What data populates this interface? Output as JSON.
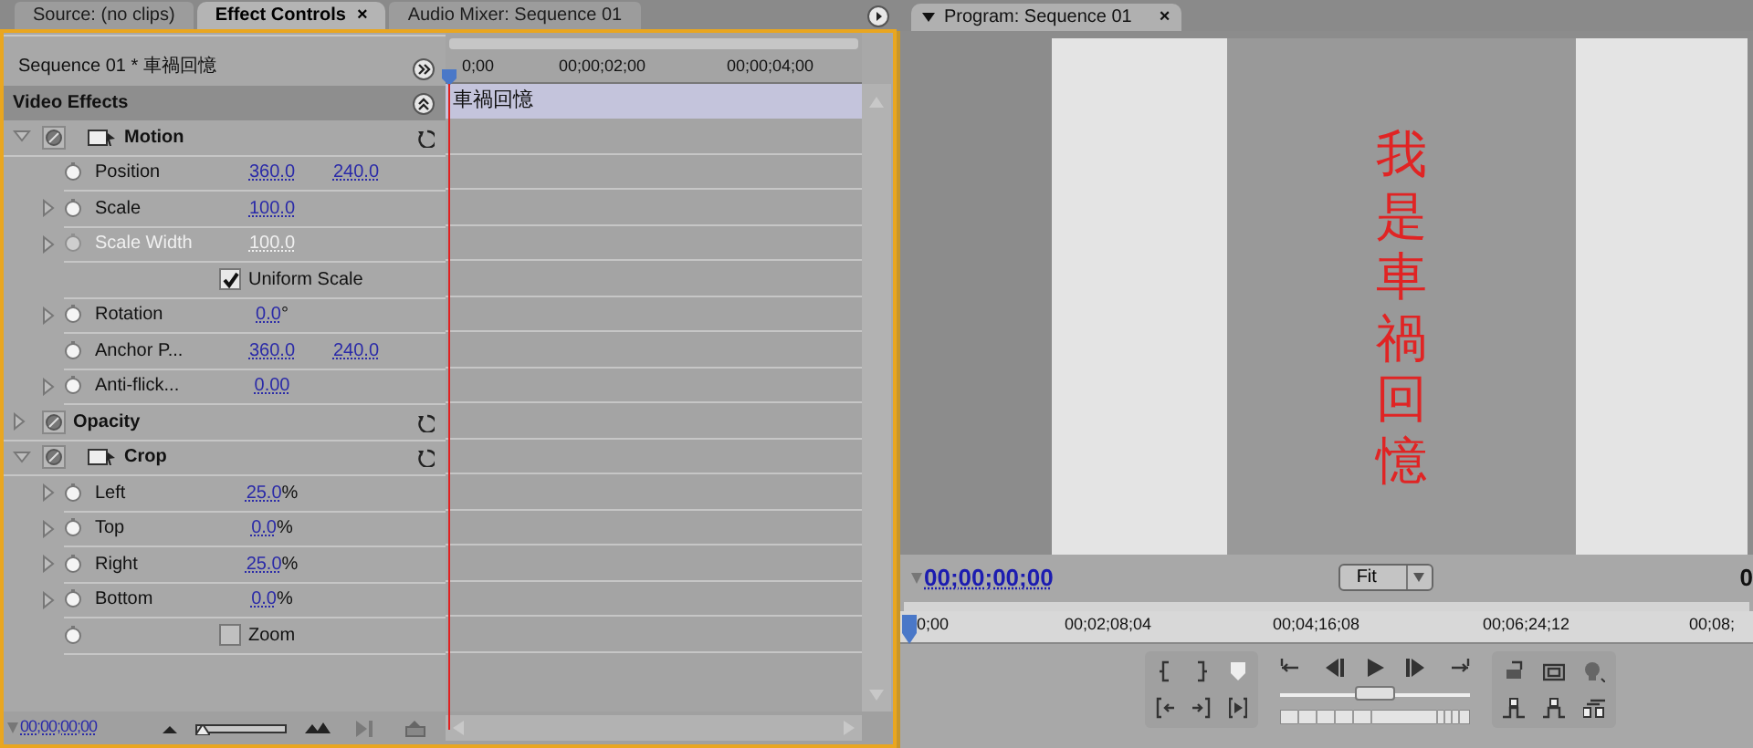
{
  "left_tabs": [
    {
      "label": "Source: (no clips)",
      "selected": false
    },
    {
      "label": "Effect Controls",
      "selected": true,
      "close": "×"
    },
    {
      "label": "Audio Mixer: Sequence 01",
      "selected": false
    }
  ],
  "effect_controls": {
    "clip_title": "Sequence 01 * 車禍回憶",
    "ruler_labels": [
      "0;00",
      "00;00;02;00",
      "00;00;04;00"
    ],
    "clip_name": "車禍回憶",
    "section": "Video Effects",
    "rows": [
      {
        "kind": "effect",
        "name": "Motion",
        "expanded": true,
        "icon": true
      },
      {
        "kind": "property",
        "label": "Position",
        "twirl": false,
        "disabled": false,
        "values": [
          "360.0",
          "240.0"
        ]
      },
      {
        "kind": "property",
        "label": "Scale",
        "twirl": true,
        "disabled": false,
        "values": [
          "100.0"
        ]
      },
      {
        "kind": "property",
        "label": "Scale Width",
        "twirl": true,
        "disabled": true,
        "values": [
          "100.0"
        ]
      },
      {
        "kind": "checkbox",
        "label": "Uniform Scale",
        "checked": true,
        "stopwatch": false
      },
      {
        "kind": "property",
        "label": "Rotation",
        "twirl": true,
        "disabled": false,
        "values": [
          "0.0"
        ],
        "unit": "°"
      },
      {
        "kind": "property",
        "label": "Anchor P...",
        "twirl": false,
        "disabled": false,
        "values": [
          "360.0",
          "240.0"
        ]
      },
      {
        "kind": "property",
        "label": "Anti-flick...",
        "twirl": true,
        "disabled": false,
        "values": [
          "0.00"
        ]
      },
      {
        "kind": "effect",
        "name": "Opacity",
        "expanded": false,
        "icon": false
      },
      {
        "kind": "effect",
        "name": "Crop",
        "expanded": true,
        "icon": true
      },
      {
        "kind": "property",
        "label": "Left",
        "twirl": true,
        "disabled": false,
        "values": [
          "25.0"
        ],
        "unit": "%"
      },
      {
        "kind": "property",
        "label": "Top",
        "twirl": true,
        "disabled": false,
        "values": [
          "0.0"
        ],
        "unit": "%"
      },
      {
        "kind": "property",
        "label": "Right",
        "twirl": true,
        "disabled": false,
        "values": [
          "25.0"
        ],
        "unit": "%"
      },
      {
        "kind": "property",
        "label": "Bottom",
        "twirl": true,
        "disabled": false,
        "values": [
          "0.0"
        ],
        "unit": "%"
      },
      {
        "kind": "checkbox",
        "label": "Zoom",
        "checked": false,
        "stopwatch": true
      }
    ],
    "zoom_slider": {
      "level": 0.05
    },
    "timecode": "00;00;00;00"
  },
  "program_monitor": {
    "tab": {
      "label": "Program: Sequence 01",
      "close": "×",
      "selected": true
    },
    "frame_text": "我是車禍回憶",
    "timecode": "00;00;00;00",
    "zoom": "Fit",
    "duration": "0",
    "ruler_labels": [
      "0;00",
      "00;02;08;04",
      "00;04;16;08",
      "00;06;24;12",
      "00;08;"
    ],
    "shuttle": {
      "level": 0.5
    }
  }
}
